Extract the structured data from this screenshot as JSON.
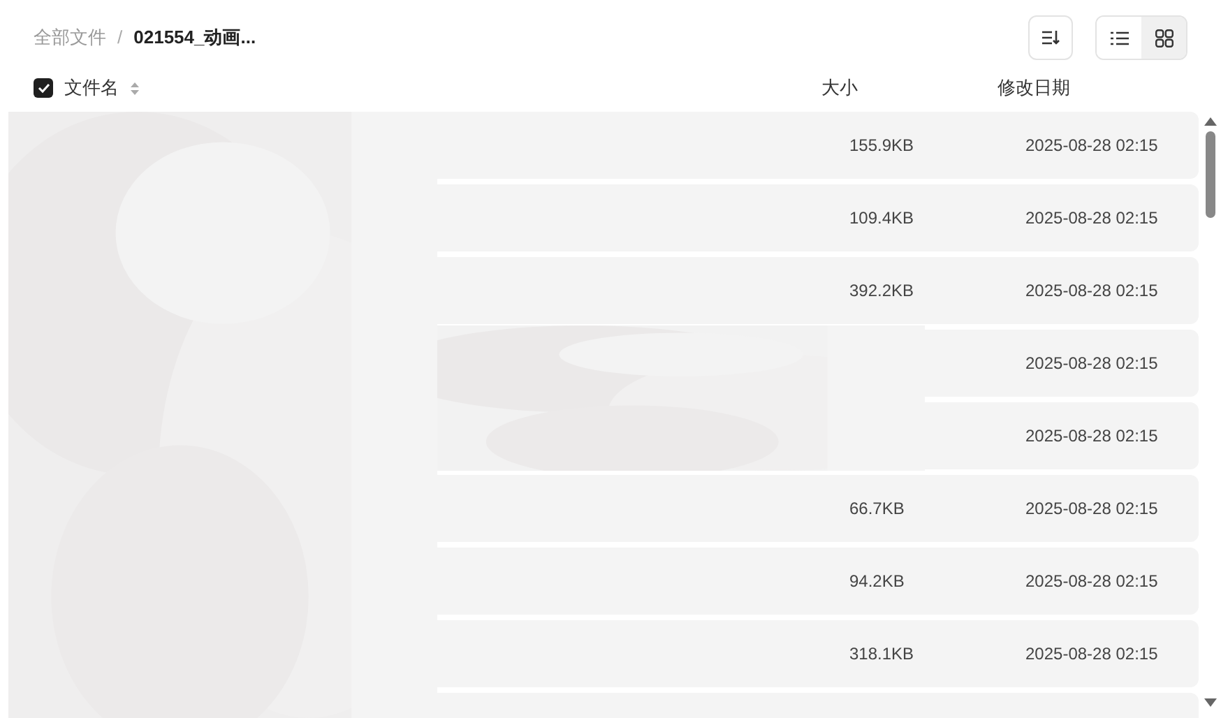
{
  "breadcrumb": [
    {
      "label": "全部文件",
      "current": false
    },
    {
      "label": "021554_动画...",
      "current": true
    }
  ],
  "breadcrumb_separator": "/",
  "view_toggle": [
    {
      "kind": "list",
      "selected": false
    },
    {
      "kind": "grid",
      "selected": true
    }
  ],
  "table": {
    "select_all": {
      "checked": true
    },
    "columns": [
      "文件名",
      "大小",
      "修改日期"
    ],
    "rows": [
      {
        "size": "155.9KB",
        "date": "2025-08-28 02:15"
      },
      {
        "size": "109.4KB",
        "date": "2025-08-28 02:15"
      },
      {
        "size": "392.2KB",
        "date": "2025-08-28 02:15"
      },
      {
        "date": "2025-08-28 02:15"
      },
      {
        "date": "2025-08-28 02:15"
      },
      {
        "size": "66.7KB",
        "date": "2025-08-28 02:15"
      },
      {
        "size": "94.2KB",
        "date": "2025-08-28 02:15"
      },
      {
        "size": "318.1KB",
        "date": "2025-08-28 02:15"
      }
    ]
  }
}
